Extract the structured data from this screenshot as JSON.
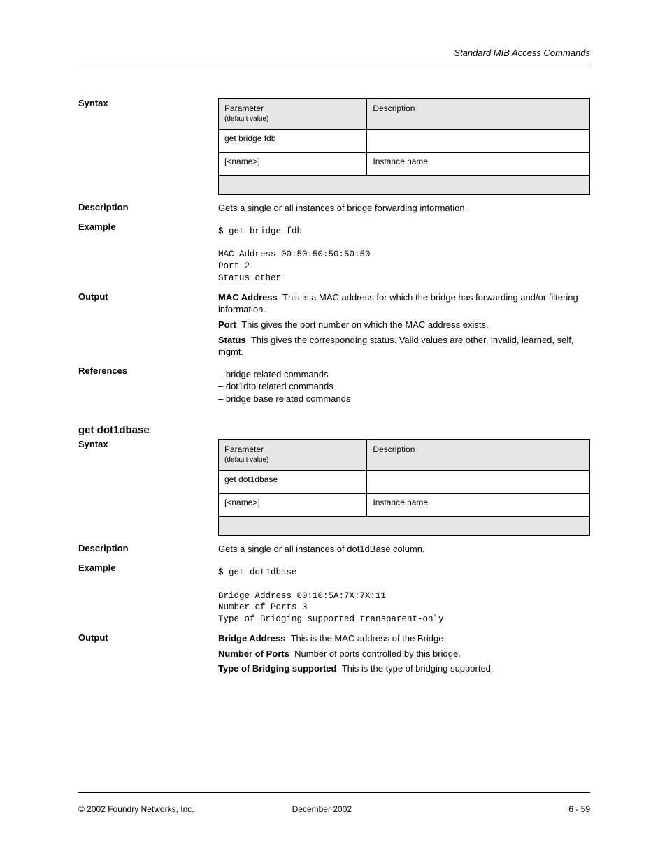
{
  "running_head": "Standard MIB Access Commands",
  "sections": [
    {
      "id": "get-bridge-fdb",
      "rows": [
        {
          "label": "Syntax",
          "type": "table",
          "table": {
            "head": [
              "Parameter",
              "Description"
            ],
            "head_sub": [
              "(default value)",
              ""
            ],
            "rows": [
              [
                "get bridge fdb",
                ""
              ],
              [
                "[<name>]",
                "Instance name"
              ]
            ],
            "footnote": ""
          }
        },
        {
          "label": "Description",
          "type": "text",
          "text": "Gets a single or all instances of bridge forwarding information."
        },
        {
          "label": "Example",
          "type": "pre",
          "lines": [
            "$ get bridge fdb",
            "",
            "MAC Address   00:50:50:50:50:50",
            "Port          2",
            "Status        other"
          ]
        },
        {
          "label": "Output",
          "type": "defs",
          "defs": [
            {
              "term": "MAC Address",
              "def": "This is a MAC address for which the bridge has forwarding and/or filtering information."
            },
            {
              "term": "Port",
              "def": "This gives the port number on which the MAC address exists."
            },
            {
              "term": "Status",
              "def": "This gives the corresponding status. Valid values are other, invalid, learned, self, mgmt."
            }
          ]
        },
        {
          "label": "References",
          "type": "list",
          "items": [
            "bridge related commands",
            "dot1dtp related commands",
            "bridge base related commands"
          ]
        }
      ]
    },
    {
      "id": "get-dot1dbase",
      "title": "get dot1dbase",
      "rows": [
        {
          "label": "Syntax",
          "type": "table",
          "table": {
            "head": [
              "Parameter",
              "Description"
            ],
            "head_sub": [
              "(default value)",
              ""
            ],
            "rows": [
              [
                "get dot1dbase",
                ""
              ],
              [
                "[<name>]",
                "Instance name"
              ]
            ],
            "footnote": ""
          }
        },
        {
          "label": "Description",
          "type": "text",
          "text": "Gets a single or all instances of dot1dBase column."
        },
        {
          "label": "Example",
          "type": "pre",
          "lines": [
            "$ get dot1dbase",
            "",
            "Bridge Address              00:10:5A:7X:7X:11",
            "Number of Ports             3",
            "Type of Bridging supported  transparent-only"
          ]
        },
        {
          "label": "Output",
          "type": "defs",
          "defs": [
            {
              "term": "Bridge Address",
              "def": "This is the MAC address of the Bridge."
            },
            {
              "term": "Number of Ports",
              "def": "Number of ports controlled by this bridge."
            },
            {
              "term": "Type of Bridging supported",
              "def": "This is the type of bridging supported."
            }
          ]
        }
      ]
    }
  ],
  "footer": {
    "copyright": "© 2002 Foundry Networks, Inc.",
    "date": "December 2002",
    "page": "6 - 59"
  }
}
